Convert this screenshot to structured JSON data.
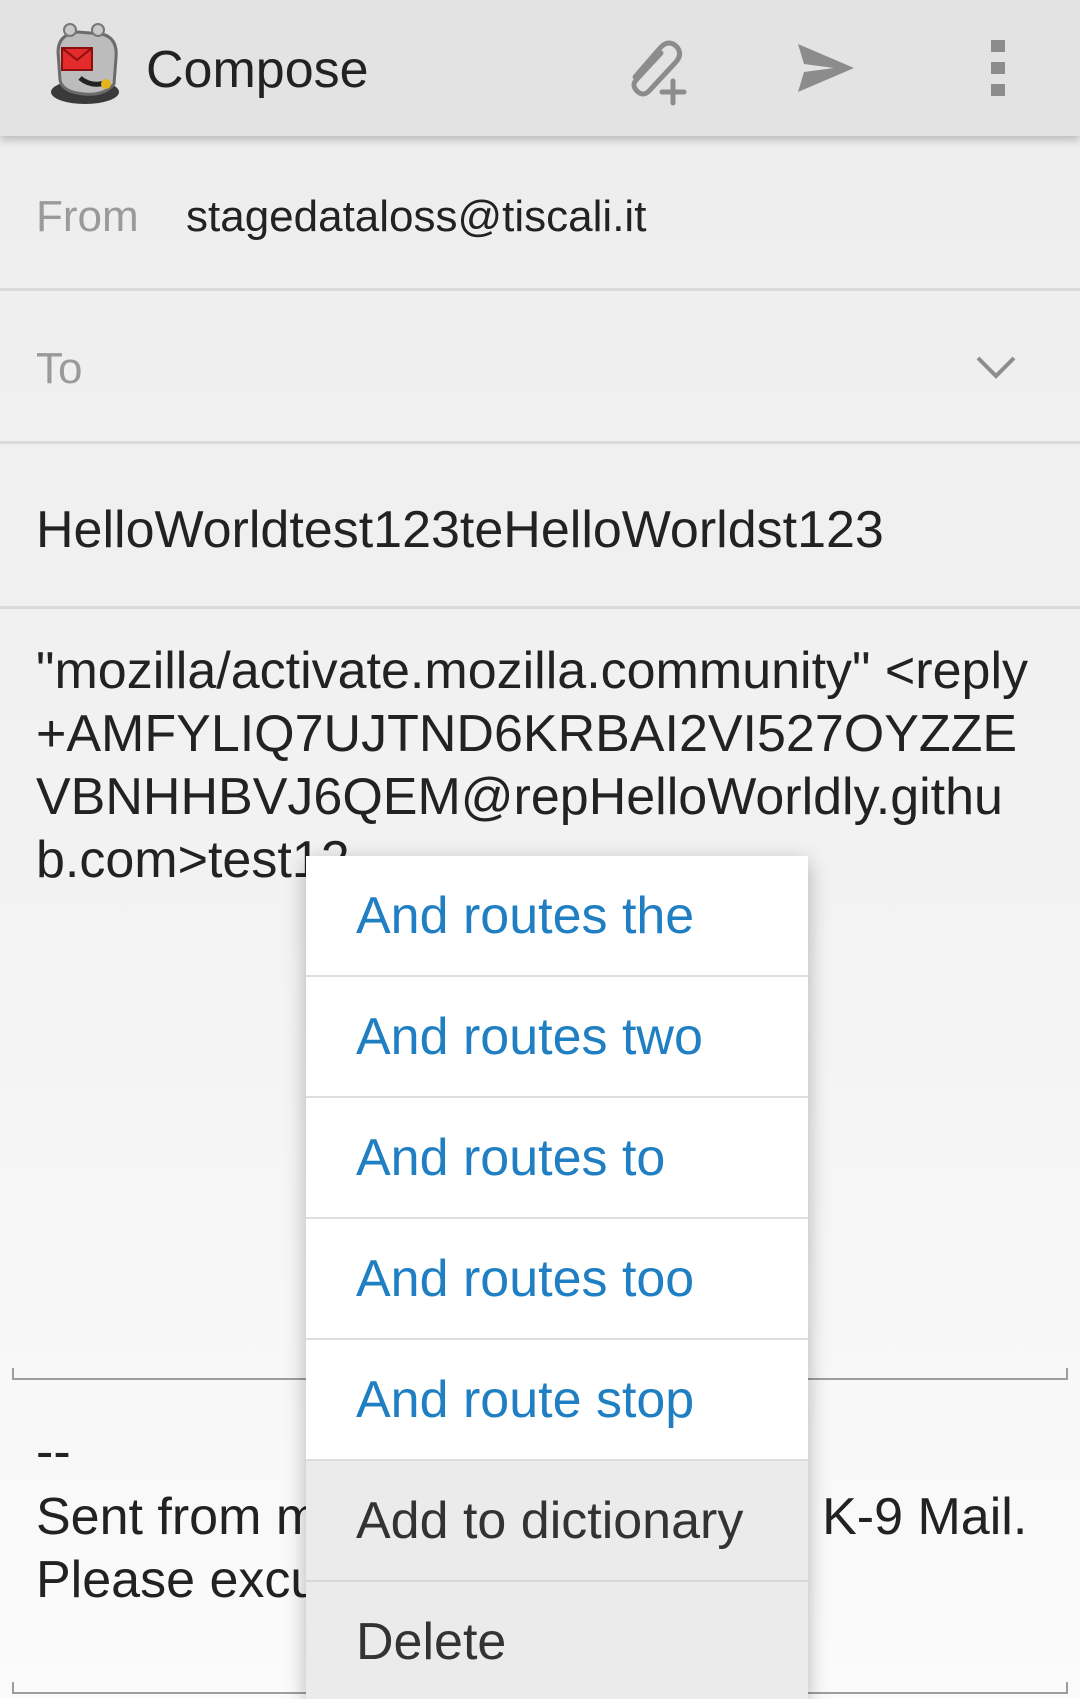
{
  "appbar": {
    "title": "Compose",
    "actions": [
      "attach-icon",
      "send-icon",
      "overflow-menu-icon"
    ]
  },
  "form": {
    "from_label": "From",
    "from_value": "stagedataloss@tiscali.it",
    "to_label": "To",
    "subject": "HelloWorldtest123teHelloWorldst123",
    "body": "\"mozilla/activate.mozilla.community\" <reply+AMFYLIQ7UJTND6KRBAI2VI527OYZZEVBNHHBVJ6QEM@repHelloWorldly.github.com>test12",
    "signature_dash": "--",
    "signature": "Sent from my Android device with K-9 Mail. Please excuse my brevity."
  },
  "context_menu": {
    "suggestions": [
      "And routes the",
      "And routes two",
      "And routes to",
      "And routes too",
      "And route stop"
    ],
    "add_to_dictionary": "Add to dictionary",
    "delete": "Delete"
  },
  "colors": {
    "appbar_bg": "#e3e3e3",
    "suggestion_text": "#1f7fc2",
    "label_gray": "#9a9a9a"
  }
}
